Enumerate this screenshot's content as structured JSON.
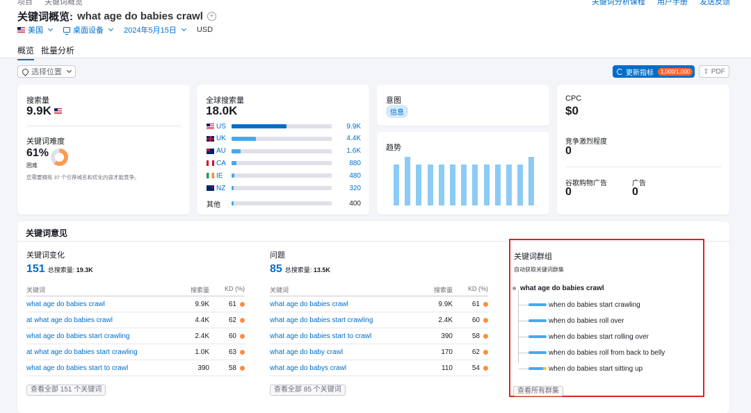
{
  "breadcrumbs": [
    "项目",
    "关键词概览"
  ],
  "top_actions": [
    "关键词分析课程",
    "用户手册",
    "发送反馈"
  ],
  "header": {
    "title_prefix": "关键词概览:",
    "keyword": "what age do babies crawl",
    "country": "美国",
    "device": "桌面设备",
    "date": "2024年5月15日",
    "currency": "USD"
  },
  "tabs": [
    {
      "label": "概览"
    },
    {
      "label": "批量分析"
    }
  ],
  "toolbar": {
    "location": "选择位置",
    "refresh": "更新指标",
    "quota": "1,000/1,000",
    "pdf": "PDF"
  },
  "volume": {
    "label": "搜索量",
    "value": "9.9K",
    "difficulty_label": "关键词难度",
    "difficulty_value": "61%",
    "difficulty_level": "困难",
    "difficulty_percent": 61,
    "note": "您需要拥有 37 个引荐域名和优化内容才能竞争。"
  },
  "global": {
    "label": "全球搜索量",
    "value": "18.0K",
    "countries": [
      {
        "code": "US",
        "value": "9.9K",
        "share": 0.55
      },
      {
        "code": "UK",
        "value": "4.4K",
        "share": 0.24
      },
      {
        "code": "AU",
        "value": "1.6K",
        "share": 0.09
      },
      {
        "code": "CA",
        "value": "880",
        "share": 0.05
      },
      {
        "code": "IE",
        "value": "480",
        "share": 0.027
      },
      {
        "code": "NZ",
        "value": "320",
        "share": 0.018
      }
    ],
    "other": {
      "label": "其他",
      "value": "400",
      "share": 0.022
    }
  },
  "intent": {
    "label": "意图",
    "badge": "信息"
  },
  "trend": {
    "label": "趋势",
    "values": [
      0.84,
      1.0,
      0.84,
      0.84,
      0.84,
      0.84,
      0.84,
      0.84,
      0.84,
      0.84,
      0.84,
      0.84,
      1.0
    ]
  },
  "metrics": {
    "cpc_label": "CPC",
    "cpc_value": "$0",
    "competition_label": "竞争激烈程度",
    "competition_value": "0",
    "shopping_label": "谷歌购物广告",
    "shopping_value": "0",
    "ads_label": "广告",
    "ads_value": "0"
  },
  "ideas": {
    "title": "关键词意见",
    "variations": {
      "title": "关键词变化",
      "count": "151",
      "total_label": "总搜索量:",
      "total_value": "19.3K",
      "col_keyword": "关键词",
      "col_volume": "搜索量",
      "col_kd": "KD (%)",
      "rows": [
        {
          "keyword": "what age do babies crawl",
          "volume": "9.9K",
          "kd": "61"
        },
        {
          "keyword": "at what age do babies crawl",
          "volume": "4.4K",
          "kd": "62"
        },
        {
          "keyword": "what age do babies start crawling",
          "volume": "2.4K",
          "kd": "60"
        },
        {
          "keyword": "at what age do babies start crawling",
          "volume": "1.0K",
          "kd": "63"
        },
        {
          "keyword": "what age do babies start to crawl",
          "volume": "390",
          "kd": "58"
        }
      ],
      "view_all": "查看全部 151 个关键词"
    },
    "questions": {
      "title": "问题",
      "count": "85",
      "total_label": "总搜索量:",
      "total_value": "13.5K",
      "col_keyword": "关键词",
      "col_volume": "搜索量",
      "col_kd": "KD (%)",
      "rows": [
        {
          "keyword": "what age do babies crawl",
          "volume": "9.9K",
          "kd": "61"
        },
        {
          "keyword": "what age do babies start crawling",
          "volume": "2.4K",
          "kd": "60"
        },
        {
          "keyword": "what age do babies start to crawl",
          "volume": "390",
          "kd": "58"
        },
        {
          "keyword": "what age do baby crawl",
          "volume": "170",
          "kd": "62"
        },
        {
          "keyword": "what age do babys crawl",
          "volume": "110",
          "kd": "54"
        }
      ],
      "view_all": "查看全部 85 个关键词"
    },
    "clusters": {
      "title": "关键词群组",
      "subtitle": "自动获取关键词群集",
      "root": "what age do babies crawl",
      "items": [
        "when do babies start crawling",
        "when do babies roll over",
        "when do babies start rolling over",
        "when do babies roll from back to belly",
        "when do babies start sitting up"
      ],
      "view_all": "查看所有群集"
    }
  },
  "colors": {
    "accent": "#006dca",
    "bar": "#45a9ef",
    "kd_dot": "#ff8c43",
    "highlight": "#e0211b",
    "quota": "#ff642d"
  }
}
